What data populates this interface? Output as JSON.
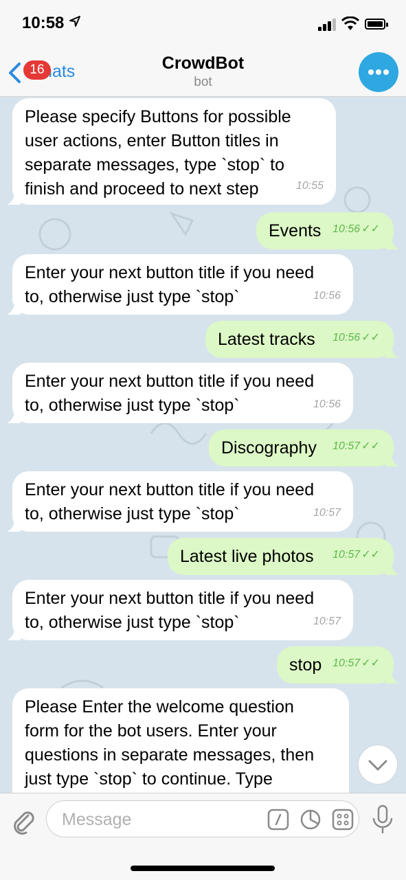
{
  "status_bar": {
    "time": "10:58",
    "location_icon": "location-arrow-icon"
  },
  "header": {
    "back_label": "Chats",
    "unread_badge": "16",
    "title": "CrowdBot",
    "subtitle": "bot",
    "accent_color": "#2a8ae0"
  },
  "messages": [
    {
      "dir": "in",
      "text": "Please specify Buttons for possible\nuser actions, enter Button titles in\nseparate messages, type `stop` to\nfinish and proceed to next step",
      "time": "10:55"
    },
    {
      "dir": "out",
      "text": "Events",
      "time": "10:56"
    },
    {
      "dir": "in",
      "text": "Enter your next button title if you need\nto, otherwise just type `stop`",
      "time": "10:56"
    },
    {
      "dir": "out",
      "text": "Latest tracks",
      "time": "10:56"
    },
    {
      "dir": "in",
      "text": "Enter your next button title if you need\nto, otherwise just type `stop`",
      "time": "10:56"
    },
    {
      "dir": "out",
      "text": "Discography",
      "time": "10:57"
    },
    {
      "dir": "in",
      "text": "Enter your next button title if you need\nto, otherwise just type `stop`",
      "time": "10:57"
    },
    {
      "dir": "out",
      "text": "Latest live photos",
      "time": "10:57"
    },
    {
      "dir": "in",
      "text": "Enter your next button title if you need\nto, otherwise just type `stop`",
      "time": "10:57"
    },
    {
      "dir": "out",
      "text": "stop",
      "time": "10:57"
    },
    {
      "dir": "in",
      "text": "Please Enter the welcome question\nform for the bot users. Enter your\nquestions in separate messages, then\njust type `stop` to continue. Type",
      "time": ""
    }
  ],
  "input": {
    "placeholder": "Message"
  },
  "colors": {
    "incoming_bubble": "#ffffff",
    "outgoing_bubble": "#dcf8c6",
    "outgoing_time": "#5cb84a",
    "chat_bg": "#d7e3ec"
  }
}
